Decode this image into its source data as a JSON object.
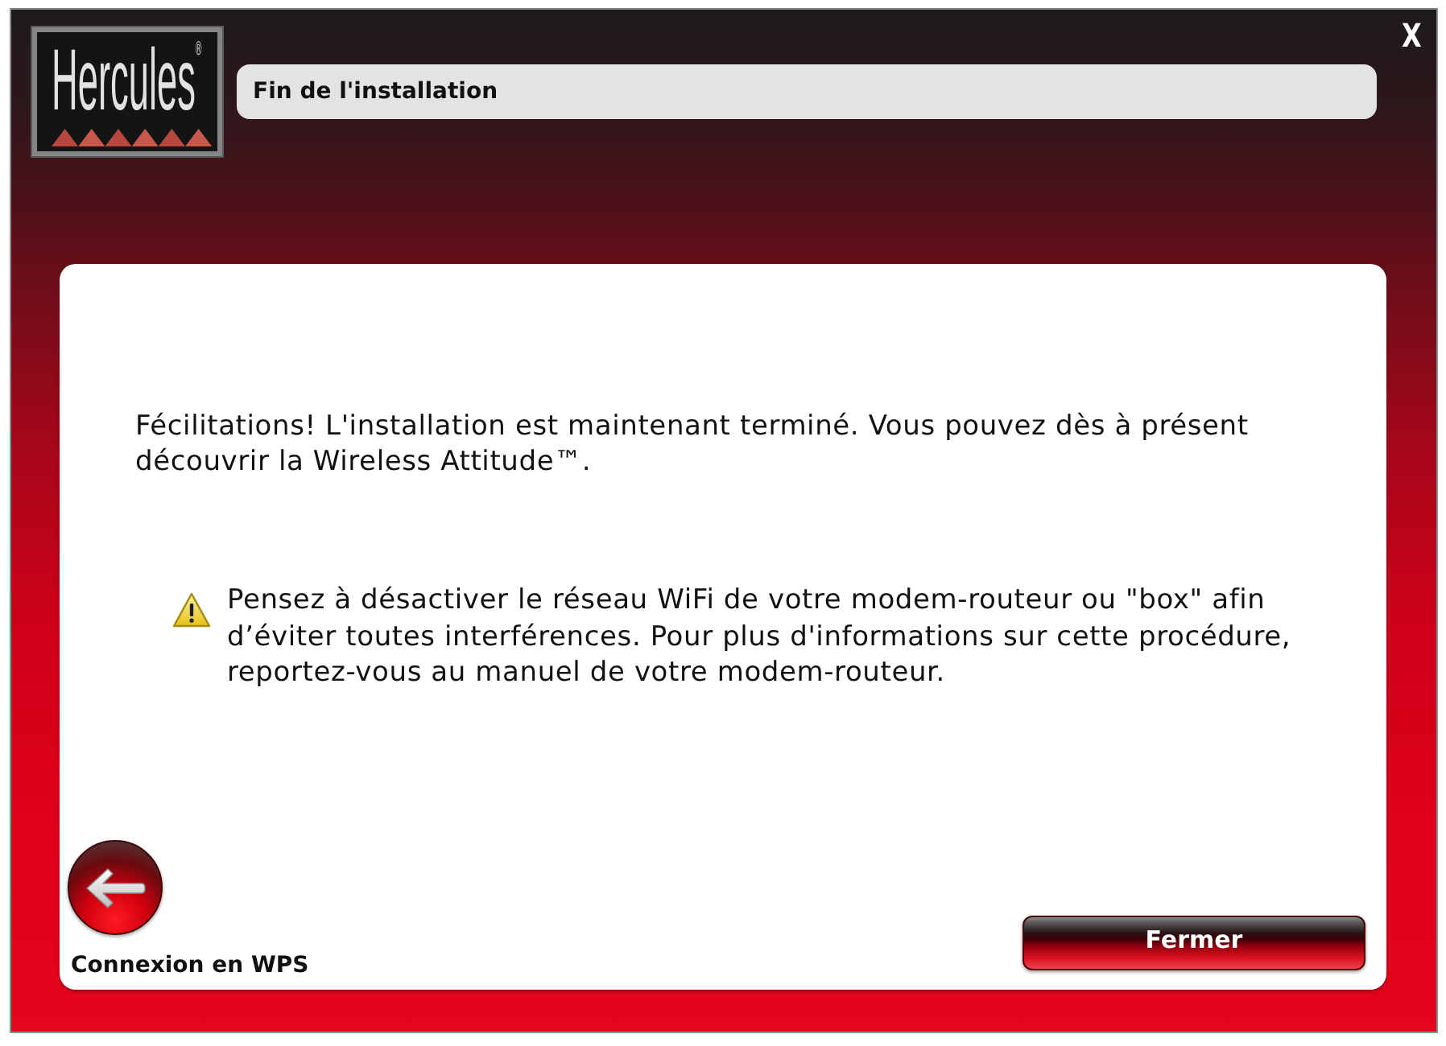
{
  "window": {
    "title": "Fin de l'installation",
    "close": "X"
  },
  "logo": {
    "text": "Hercules$^{®}$"
  },
  "message": {
    "text": "Fécilitations! L'installation est maintenant terminé. Vous pouvez dès à présent découvrir la Wireless Attitude™."
  },
  "warning": {
    "text": "Pensez à désactiver le réseau WiFi de votre modem-routeur ou \"box\" afin d’éviter toutes interférences. Pour plus d'informations sur cette procédure, reportez-vous au manuel de votre modem-routeur."
  },
  "back": {
    "label": "Connexion en WPS"
  },
  "buttons": [
    {
      "label": "Fermer"
    }
  ]
}
